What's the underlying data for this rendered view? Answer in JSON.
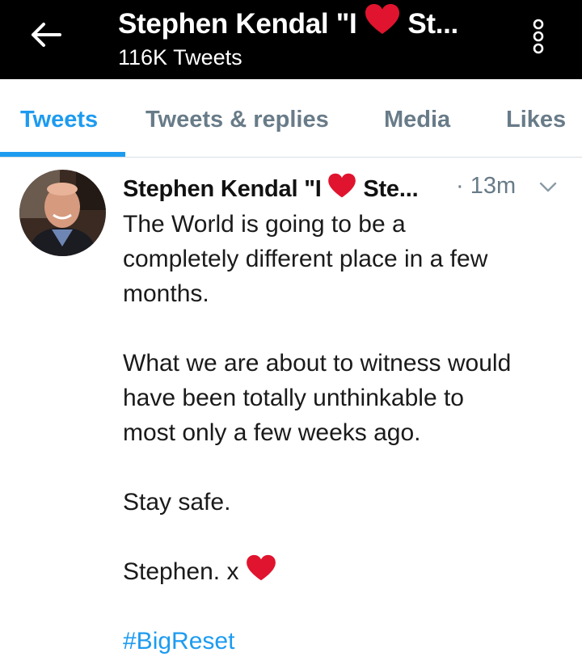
{
  "header": {
    "title_start": "Stephen Kendal \"I",
    "title_end": "St...",
    "tweet_count": "116K Tweets"
  },
  "tabs": [
    {
      "label": "Tweets",
      "active": true
    },
    {
      "label": "Tweets & replies",
      "active": false
    },
    {
      "label": "Media",
      "active": false
    },
    {
      "label": "Likes",
      "active": false
    }
  ],
  "tweet": {
    "name_start": "Stephen Kendal \"I",
    "name_end": "Ste...",
    "time": "· 13m",
    "lines": [
      "The World is going to be a",
      "completely different place in a few",
      "months."
    ],
    "para2": [
      "What we are about to witness would",
      "have been totally unthinkable to",
      "most only a few weeks ago."
    ],
    "para3": "Stay safe.",
    "signoff": "Stephen. x",
    "hashtag": "#BigReset"
  },
  "colors": {
    "accent": "#1d9bf0",
    "heart": "#e0142e",
    "muted": "#687b88"
  },
  "icons": [
    "back-arrow-icon",
    "heart-emoji-icon",
    "more-vertical-icon",
    "chevron-down-icon"
  ]
}
